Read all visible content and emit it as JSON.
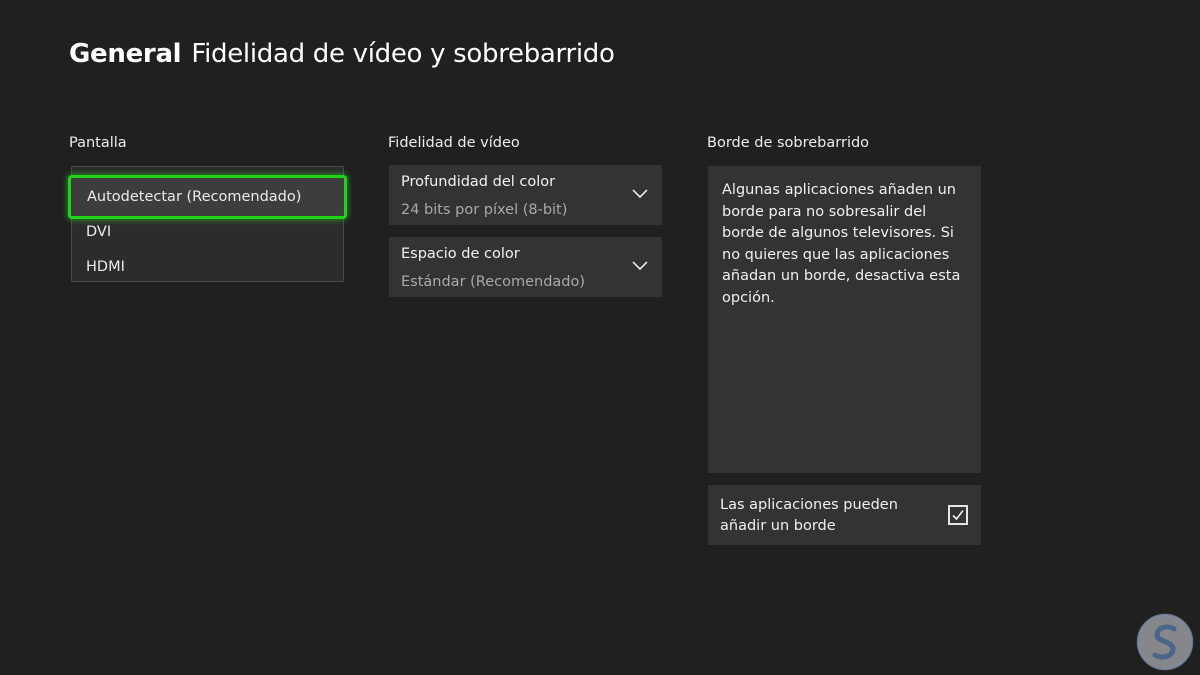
{
  "header": {
    "section": "General",
    "title": "Fidelidad de vídeo y sobrebarrido"
  },
  "display": {
    "heading": "Pantalla",
    "options": [
      {
        "label": "Autodetectar (Recomendado)",
        "selected": true
      },
      {
        "label": "DVI",
        "selected": false
      },
      {
        "label": "HDMI",
        "selected": false
      }
    ]
  },
  "video": {
    "heading": "Fidelidad de vídeo",
    "settings": [
      {
        "label": "Profundidad del color",
        "value": "24 bits por píxel (8-bit)"
      },
      {
        "label": "Espacio de color",
        "value": "Estándar (Recomendado)"
      }
    ]
  },
  "overscan": {
    "heading": "Borde de sobrebarrido",
    "description": "Algunas aplicaciones añaden un borde para no sobresalir del borde de algunos televisores. Si no quieres que las aplicaciones añadan un borde, desactiva esta opción.",
    "toggle": {
      "label": "Las aplicaciones pueden añadir un borde",
      "checked": true
    }
  },
  "icons": {
    "chevron": "chevron-down-icon",
    "checkbox": "checkmark-icon",
    "logo": "watermark-logo"
  },
  "colors": {
    "background": "#202020",
    "panel": "#333333",
    "focus": "#1ed318",
    "secondary_text": "#a9a9a9"
  }
}
